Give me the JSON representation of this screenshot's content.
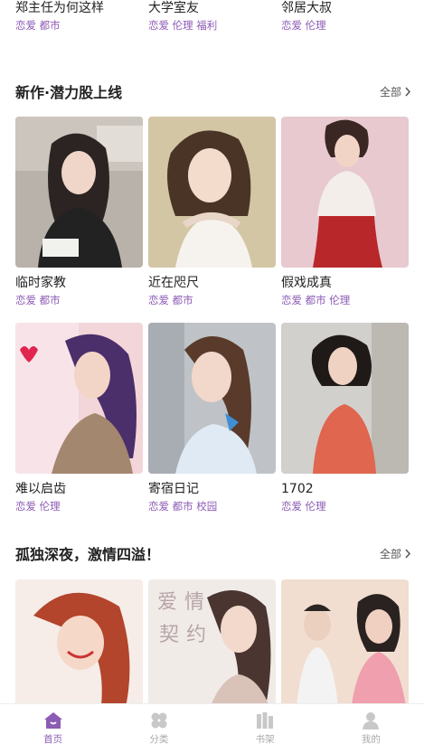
{
  "top_row": [
    {
      "title": "郑主任为何这样",
      "tags": "恋爱 都市"
    },
    {
      "title": "大学室友",
      "tags": "恋爱 伦理 福利"
    },
    {
      "title": "邻居大叔",
      "tags": "恋爱 伦理"
    }
  ],
  "section1": {
    "title": "新作·潜力股上线",
    "more": "全部",
    "items": [
      {
        "title": "临时家教",
        "tags": "恋爱 都市"
      },
      {
        "title": "近在咫尺",
        "tags": "恋爱 都市"
      },
      {
        "title": "假戏成真",
        "tags": "恋爱 都市 伦理"
      },
      {
        "title": "难以启齿",
        "tags": "恋爱 伦理"
      },
      {
        "title": "寄宿日记",
        "tags": "恋爱 都市 校园"
      },
      {
        "title": "1702",
        "tags": "恋爱 伦理"
      }
    ]
  },
  "section2": {
    "title": "孤独深夜，激情四溢！",
    "more": "全部",
    "cover_text": "爱情契约"
  },
  "tabbar": {
    "items": [
      {
        "label": "首页",
        "icon": "home-icon",
        "active": true
      },
      {
        "label": "分类",
        "icon": "category-icon",
        "active": false
      },
      {
        "label": "书架",
        "icon": "bookshelf-icon",
        "active": false
      },
      {
        "label": "我的",
        "icon": "profile-icon",
        "active": false
      }
    ],
    "active_color": "#8c5bb5",
    "inactive_color": "#aaaaaa"
  }
}
